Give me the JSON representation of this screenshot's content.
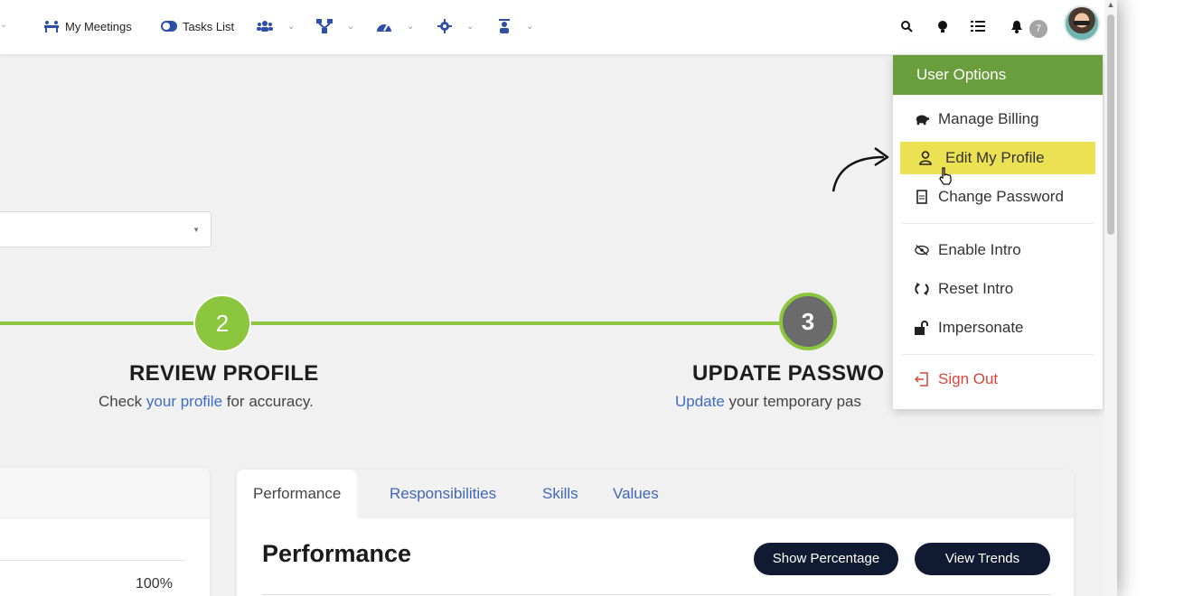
{
  "topbar": {
    "nav": [
      {
        "label": "My Meetings",
        "icon": "meeting-icon"
      },
      {
        "label": "Tasks List",
        "icon": "toggle-icon"
      },
      {
        "label": "",
        "icon": "team-icon"
      },
      {
        "label": "",
        "icon": "org-chart-icon"
      },
      {
        "label": "",
        "icon": "dashboard-gauge-icon"
      },
      {
        "label": "",
        "icon": "gear-icon"
      },
      {
        "label": "",
        "icon": "trainer-icon"
      }
    ],
    "notification_count": "7"
  },
  "stepper": {
    "step2": {
      "number": "2",
      "title": "REVIEW PROFILE",
      "desc_pre": "Check ",
      "desc_link": "your profile",
      "desc_post": " for accuracy."
    },
    "step3": {
      "number": "3",
      "title": "UPDATE PASSWO",
      "desc_link": "Update",
      "desc_post": " your temporary pas"
    }
  },
  "left_card": {
    "percent": "100%"
  },
  "performance": {
    "tabs": [
      "Performance",
      "Responsibilities",
      "Skills",
      "Values"
    ],
    "title": "Performance",
    "show_percentage": "Show Percentage",
    "view_trends": "View Trends"
  },
  "user_options": {
    "header": "User Options",
    "items": [
      {
        "label": "Manage Billing",
        "icon": "piggy-bank-icon"
      },
      {
        "label": "Edit My Profile",
        "icon": "user-icon"
      },
      {
        "label": "Change Password",
        "icon": "document-icon"
      },
      {
        "label": "Enable Intro",
        "icon": "eye-slash-icon"
      },
      {
        "label": "Reset Intro",
        "icon": "refresh-icon"
      },
      {
        "label": "Impersonate",
        "icon": "unlock-icon"
      },
      {
        "label": "Sign Out",
        "icon": "sign-out-icon"
      }
    ]
  },
  "colors": {
    "green": "#8cc63f",
    "header_green": "#6a9e3d",
    "highlight": "#f7e641",
    "navy": "#101b33",
    "link": "#3f6dc4",
    "danger": "#d9443b"
  }
}
